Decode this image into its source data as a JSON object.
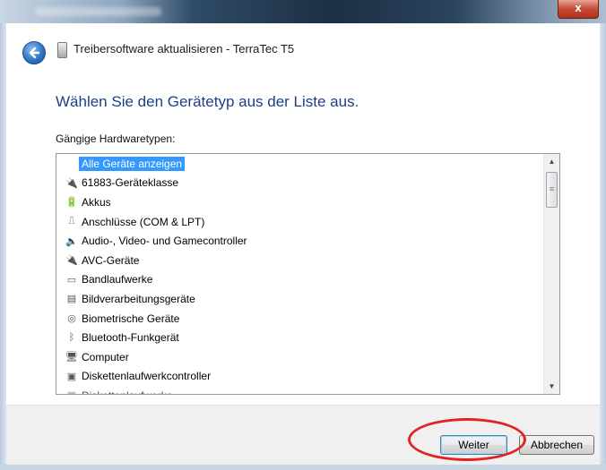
{
  "window": {
    "close_label": "x"
  },
  "header": {
    "title": "Treibersoftware aktualisieren - TerraTec T5"
  },
  "main": {
    "heading": "Wählen Sie den Gerätetyp aus der Liste aus.",
    "list_label": "Gängige Hardwaretypen:",
    "items": [
      {
        "label": "Alle Geräte anzeigen",
        "icon": "none",
        "selected": true
      },
      {
        "label": "61883-Geräteklasse",
        "icon": "plug-icon"
      },
      {
        "label": "Akkus",
        "icon": "battery-icon"
      },
      {
        "label": "Anschlüsse (COM & LPT)",
        "icon": "port-icon"
      },
      {
        "label": "Audio-, Video- und Gamecontroller",
        "icon": "speaker-icon"
      },
      {
        "label": "AVC-Geräte",
        "icon": "plug-icon"
      },
      {
        "label": "Bandlaufwerke",
        "icon": "tape-drive-icon"
      },
      {
        "label": "Bildverarbeitungsgeräte",
        "icon": "scanner-icon"
      },
      {
        "label": "Biometrische Geräte",
        "icon": "fingerprint-icon"
      },
      {
        "label": "Bluetooth-Funkgerät",
        "icon": "bluetooth-icon"
      },
      {
        "label": "Computer",
        "icon": "computer-icon"
      },
      {
        "label": "Diskettenlaufwerkcontroller",
        "icon": "floppy-controller-icon"
      },
      {
        "label": "Diskettenlaufwerke",
        "icon": "floppy-drive-icon"
      }
    ]
  },
  "footer": {
    "next_label": "Weiter",
    "cancel_label": "Abbrechen"
  },
  "colors": {
    "selection": "#3399ff",
    "heading": "#1e3f87",
    "annotation": "#e32222"
  }
}
